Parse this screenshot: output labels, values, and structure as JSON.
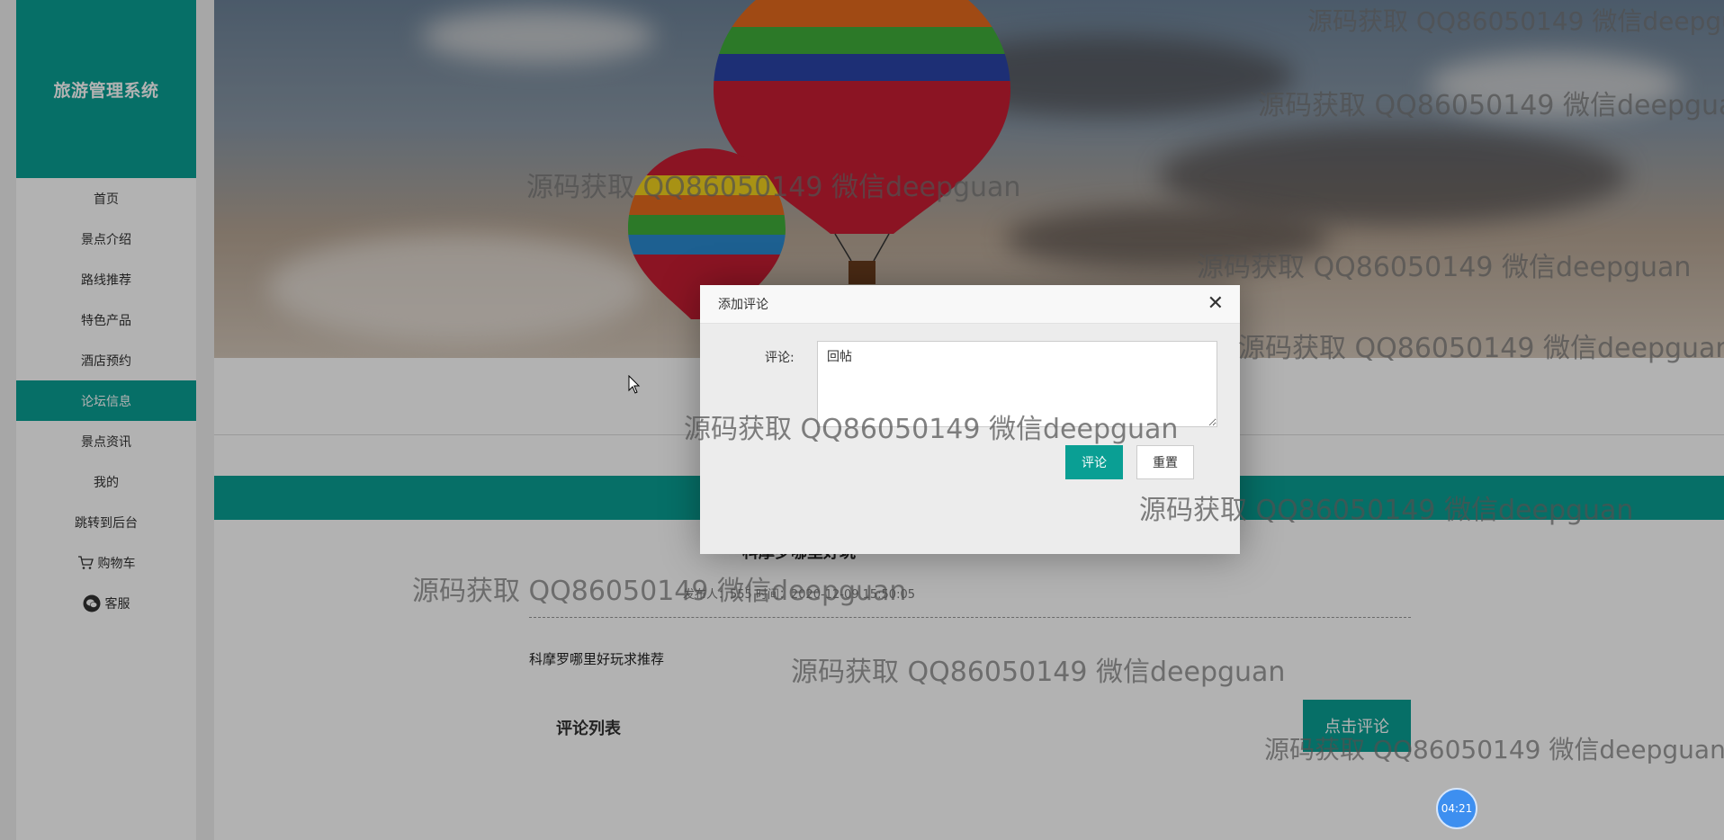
{
  "sidebar": {
    "brand": "旅游管理系统",
    "items": [
      {
        "label": "首页"
      },
      {
        "label": "景点介绍"
      },
      {
        "label": "路线推荐"
      },
      {
        "label": "特色产品"
      },
      {
        "label": "酒店预约"
      },
      {
        "label": "论坛信息",
        "active": true
      },
      {
        "label": "景点资讯"
      },
      {
        "label": "我的"
      },
      {
        "label": "跳转到后台"
      },
      {
        "label": "购物车",
        "icon": "cart-icon"
      },
      {
        "label": "客服",
        "icon": "wechat-icon"
      }
    ]
  },
  "post": {
    "title": "科摩罗哪里好玩",
    "meta": "发布人：555 时间：2020-12-09 15:50:05",
    "body": "科摩罗哪里好玩求推荐",
    "comment_list_title": "评论列表",
    "comment_button": "点击评论"
  },
  "dialog": {
    "title": "添加评论",
    "field_label": "评论:",
    "field_value": "回帖",
    "submit": "评论",
    "reset": "重置"
  },
  "timer": "04:21",
  "watermark": "源码获取 QQ86050149 微信deepguan",
  "colors": {
    "accent": "#0a9f94",
    "timer": "#3d8ff0"
  }
}
